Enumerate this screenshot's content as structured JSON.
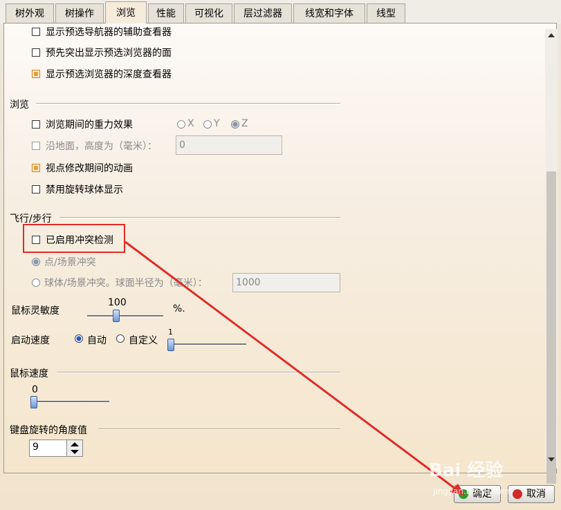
{
  "tabs": [
    {
      "label": "树外观"
    },
    {
      "label": "树操作"
    },
    {
      "label": "浏览",
      "active": true
    },
    {
      "label": "性能"
    },
    {
      "label": "可视化"
    },
    {
      "label": "层过滤器"
    },
    {
      "label": "线宽和字体"
    },
    {
      "label": "线型"
    }
  ],
  "top_section": {
    "items": [
      {
        "label": "显示预选导航器的辅助查看器",
        "checked": false
      },
      {
        "label": "预先突出显示预选浏览器的面",
        "checked": false
      },
      {
        "label": "显示预选浏览器的深度查看器",
        "checked": true
      }
    ]
  },
  "browse": {
    "title": "浏览",
    "gravity_label": "浏览期间的重力效果",
    "axis_x": "X",
    "axis_y": "Y",
    "axis_z": "Z",
    "ground_label": "沿地面，高度为（毫米）：",
    "ground_value": "0",
    "animation_label": "视点修改期间的动画",
    "disable_sphere_label": "禁用旋转球体显示"
  },
  "fly": {
    "title": "飞行/步行",
    "collision_label": "已启用冲突检测",
    "point_label": "点/场景冲突",
    "sphere_label": "球体/场景冲突。球面半径为（毫米）：",
    "sphere_value": "1000",
    "sensitivity_label": "鼠标灵敏度",
    "sensitivity_value": "100",
    "sensitivity_unit": "%.",
    "sensitivity_level": 1.0,
    "start_speed_label": "启动速度",
    "auto_label": "自动",
    "custom_label": "自定义",
    "custom_value": "1"
  },
  "mouse_speed": {
    "title": "鼠标速度",
    "value": "0",
    "level": 0.0
  },
  "keyboard": {
    "title": "键盘旋转的角度值",
    "value": "9"
  },
  "buttons": {
    "ok": "确定",
    "cancel": "取消"
  },
  "watermark": {
    "text": "Bai 经验",
    "sub": "jingyan.baidu.com"
  },
  "colors": {
    "accent_red": "#e02a2a",
    "checked_orange": "#f29a33"
  }
}
